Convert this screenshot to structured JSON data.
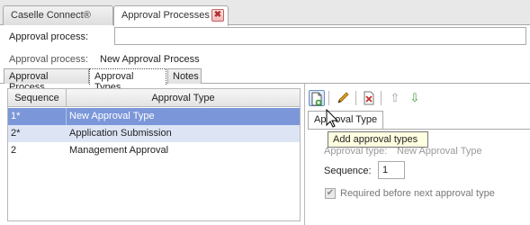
{
  "window_tabs": [
    {
      "label": "Caselle Connect®"
    },
    {
      "label": "Approval Processes",
      "close": "✖"
    }
  ],
  "approval_process_field": {
    "label": "Approval process:",
    "value": ""
  },
  "approval_process_info": {
    "label": "Approval process:",
    "value": "New Approval Process"
  },
  "subtabs": [
    {
      "label": "Approval Process"
    },
    {
      "label": "Approval Types",
      "active": true
    },
    {
      "label": "Notes"
    }
  ],
  "table": {
    "columns": [
      "Sequence",
      "Approval Type"
    ],
    "rows": [
      {
        "sequence": "1*",
        "type": "New Approval Type",
        "state": "selected"
      },
      {
        "sequence": "2*",
        "type": "Application Submission",
        "state": "secondary"
      },
      {
        "sequence": "2",
        "type": "Management Approval",
        "state": "normal"
      }
    ]
  },
  "toolbar": {
    "icons": [
      "new-document-icon",
      "pencil-icon",
      "delete-icon",
      "up-arrow-icon",
      "down-arrow-icon"
    ],
    "colors": {
      "pencil": "#e0a020",
      "delete": "#c83030",
      "up": "#9c9c9c",
      "down": "#3c9b3c"
    }
  },
  "detail": {
    "tab": "Approval Type",
    "tooltip": "Add approval types",
    "type_label": "Approval type:",
    "type_value": "New Approval Type",
    "sequence_label": "Sequence:",
    "sequence_value": "1",
    "required_label": "Required before next approval type",
    "required_checked": true
  },
  "colors": {
    "selection": "#7b97d9",
    "secondary_selection": "#dde5f5",
    "tooltip_bg": "#ffffe1"
  }
}
